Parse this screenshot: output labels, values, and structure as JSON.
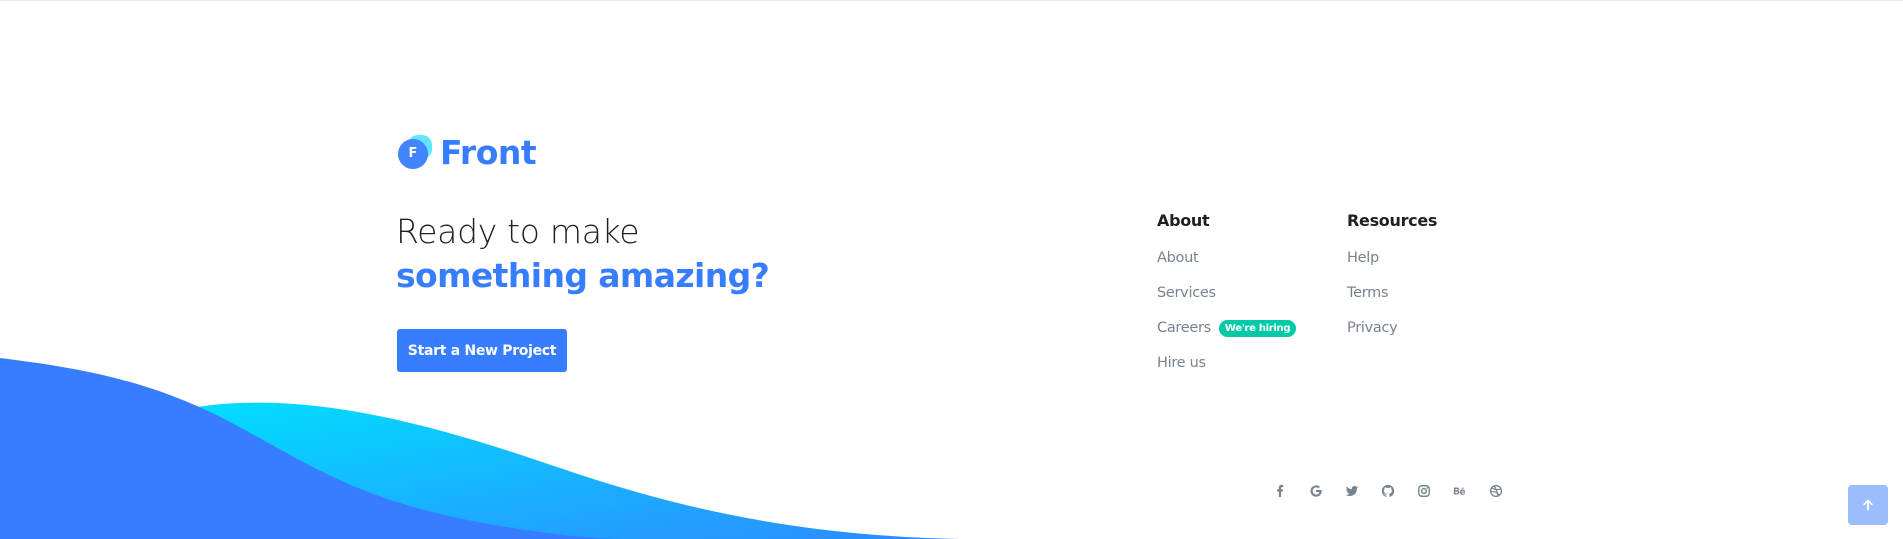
{
  "brand": {
    "logo_text": "Front",
    "logo_mark_letter": "F",
    "primary_color": "#377dff",
    "accent_color": "#00c9a7"
  },
  "hero": {
    "headline_line1": "Ready to make",
    "headline_line2": "something amazing?",
    "cta_label": "Start a New Project"
  },
  "footer": {
    "about": {
      "title": "About",
      "items": [
        {
          "label": "About"
        },
        {
          "label": "Services"
        },
        {
          "label": "Careers",
          "badge": "We're hiring"
        },
        {
          "label": "Hire us"
        }
      ]
    },
    "resources": {
      "title": "Resources",
      "items": [
        {
          "label": "Help"
        },
        {
          "label": "Terms"
        },
        {
          "label": "Privacy"
        }
      ]
    },
    "social_icons": [
      "facebook-icon",
      "google-icon",
      "twitter-icon",
      "github-icon",
      "instagram-icon",
      "behance-icon",
      "dribbble-icon"
    ]
  },
  "back_to_top": {
    "icon": "arrow-up-icon"
  }
}
